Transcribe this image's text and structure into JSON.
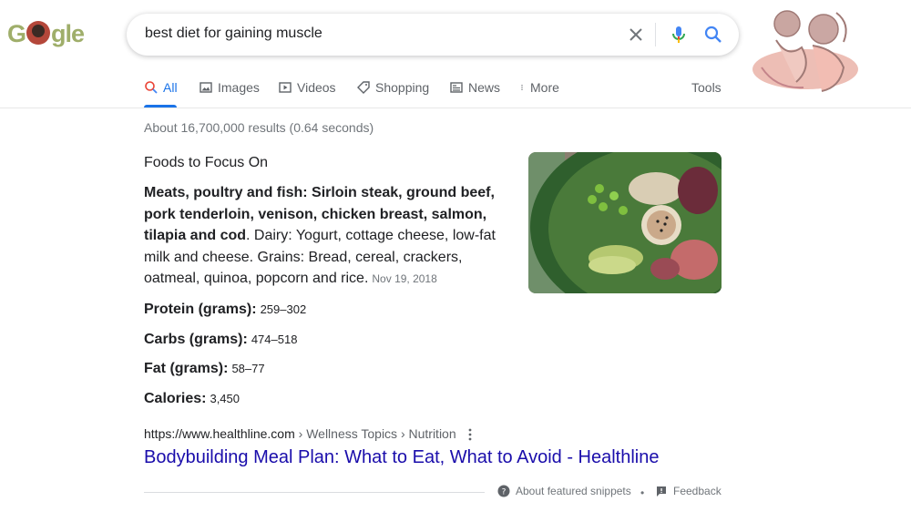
{
  "logo": {
    "text_before": "G",
    "text_after": "gle",
    "color": "#9fae6a"
  },
  "search": {
    "query": "best diet for gaining muscle"
  },
  "tabs": [
    {
      "label": "All",
      "icon": "search-icon"
    },
    {
      "label": "Images",
      "icon": "image-icon"
    },
    {
      "label": "Videos",
      "icon": "video-icon"
    },
    {
      "label": "Shopping",
      "icon": "tag-icon"
    },
    {
      "label": "News",
      "icon": "news-icon"
    },
    {
      "label": "More",
      "icon": "more-vert-icon"
    }
  ],
  "tools_label": "Tools",
  "result_stats": "About 16,700,000 results (0.64 seconds)",
  "snippet": {
    "heading": "Foods to Focus On",
    "bold_text": "Meats, poultry and fish: Sirloin steak, ground beef, pork tenderloin, venison, chicken breast, salmon, tilapia and cod",
    "rest_text": ". Dairy: Yogurt, cottage cheese, low-fat milk and cheese. Grains: Bread, cereal, crackers, oatmeal, quinoa, popcorn and rice.",
    "date": "Nov 19, 2018"
  },
  "nutrition": [
    {
      "label": "Protein (grams):",
      "value": "259–302"
    },
    {
      "label": "Carbs (grams):",
      "value": "474–518"
    },
    {
      "label": "Fat (grams):",
      "value": "58–77"
    },
    {
      "label": "Calories:",
      "value": "3,450"
    }
  ],
  "citation": {
    "url": "https://www.healthline.com",
    "crumbs": " › Wellness Topics › Nutrition"
  },
  "result_title": "Bodybuilding Meal Plan: What to Eat, What to Avoid - Healthline",
  "footer": {
    "about": "About featured snippets",
    "separator": "•",
    "feedback": "Feedback"
  },
  "colors": {
    "link": "#1a0dab",
    "accent": "#1a73e8",
    "muted": "#70757a"
  }
}
